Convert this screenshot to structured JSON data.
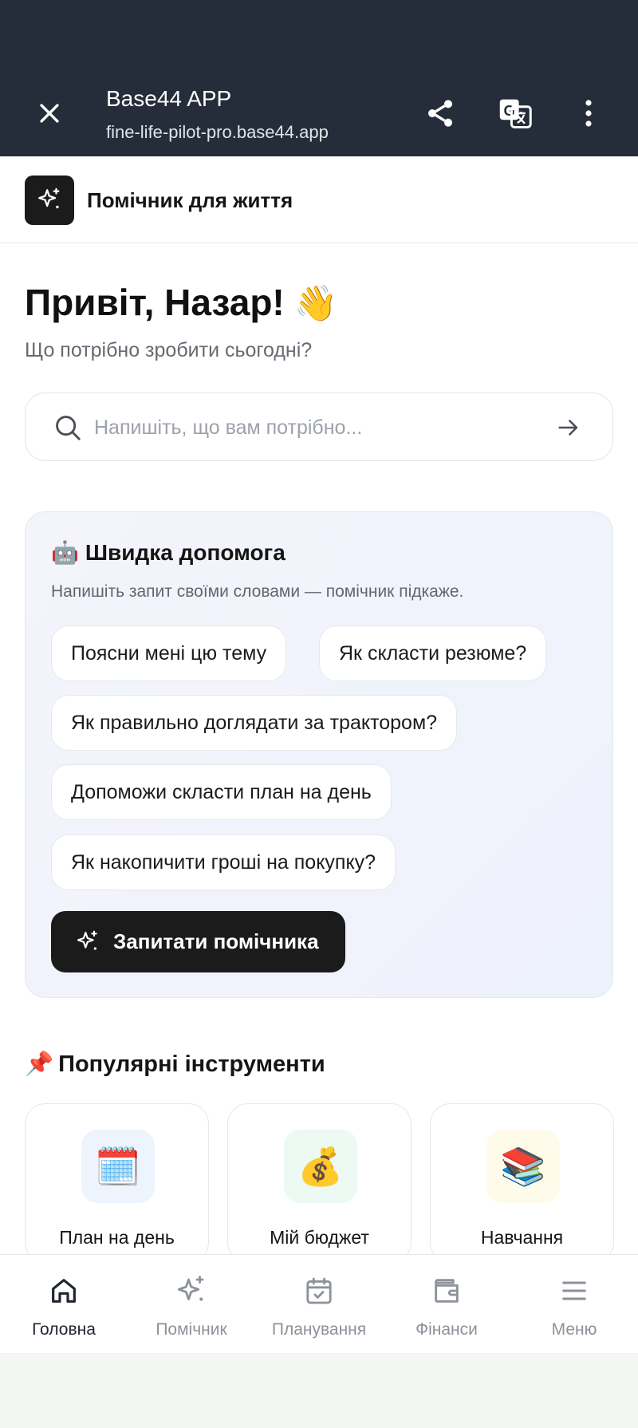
{
  "browser": {
    "title": "Base44 APP",
    "url": "fine-life-pilot-pro.base44.app",
    "close_icon": "close-icon",
    "share_icon": "share-icon",
    "translate_icon": "translate-icon",
    "more_icon": "more-vertical-icon"
  },
  "app": {
    "name": "Помічник для життя",
    "logo_icon": "sparkles-icon"
  },
  "hero": {
    "greeting": "Привіт, Назар!",
    "greeting_emoji": "👋",
    "subtitle": "Що потрібно зробити сьогодні?"
  },
  "search": {
    "placeholder": "Напишіть, що вам потрібно...",
    "value": ""
  },
  "quick_help": {
    "emoji": "🤖",
    "title": "Швидка допомога",
    "subtitle": "Напишіть запит своїми словами — помічник підкаже.",
    "suggestions": [
      "Поясни мені цю тему",
      "Як скласти резюме?",
      "Як правильно доглядати за трактором?",
      "Допоможи скласти план на день",
      "Як накопичити гроші на покупку?"
    ],
    "ask_button": "Запитати помічника"
  },
  "popular": {
    "emoji": "📌",
    "title": "Популярні інструменти",
    "tools": [
      {
        "label": "План на день",
        "emoji": "🗓️",
        "bg": "#eef4fd"
      },
      {
        "label": "Мій бюджет",
        "emoji": "💰",
        "bg": "#ecfaf3"
      },
      {
        "label": "Навчання",
        "emoji": "📚",
        "bg": "#fefbea"
      }
    ]
  },
  "nav": {
    "active": "Головна",
    "items": [
      {
        "label": "Головна",
        "icon": "home-icon"
      },
      {
        "label": "Помічник",
        "icon": "sparkles-icon"
      },
      {
        "label": "Планування",
        "icon": "calendar-check-icon"
      },
      {
        "label": "Фінанси",
        "icon": "wallet-icon"
      },
      {
        "label": "Меню",
        "icon": "menu-icon"
      }
    ]
  },
  "colors": {
    "browser_bar": "#252d3a",
    "primary": "#1b1b1b",
    "muted_text": "#666a72",
    "card_bg": "#f1f3fb"
  }
}
